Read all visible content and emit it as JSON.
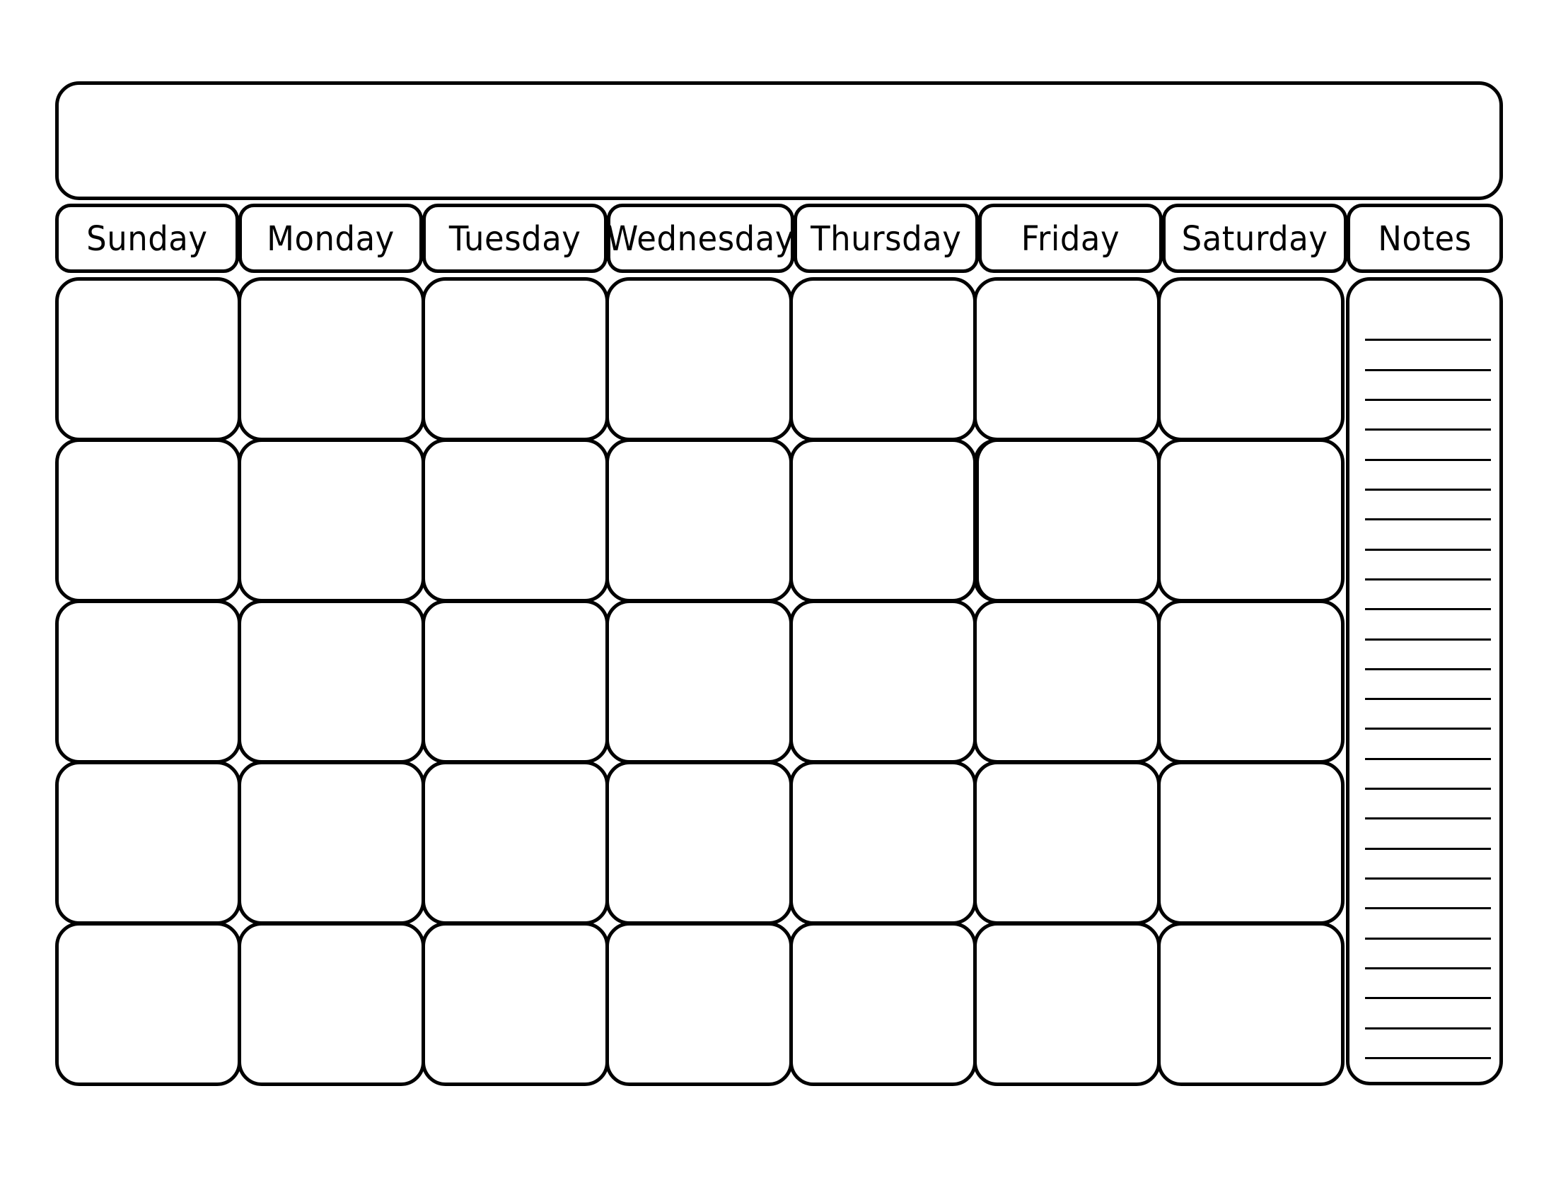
{
  "document": {
    "type": "blank-monthly-calendar-template",
    "orientation": "landscape",
    "background_color": "#ffffff",
    "line_color": "#000000"
  },
  "title_bar": {
    "label": "",
    "placeholder": ""
  },
  "header": {
    "columns": [
      {
        "label": "Sunday",
        "key": "sunday"
      },
      {
        "label": "Monday",
        "key": "monday"
      },
      {
        "label": "Tuesday",
        "key": "tuesday"
      },
      {
        "label": "Wednesday",
        "key": "wednesday"
      },
      {
        "label": "Thursday",
        "key": "thursday"
      },
      {
        "label": "Friday",
        "key": "friday"
      },
      {
        "label": "Saturday",
        "key": "saturday"
      },
      {
        "label": "Notes",
        "key": "notes"
      }
    ]
  },
  "grid": {
    "rows": 5,
    "columns": 7,
    "cells": [
      [
        "",
        "",
        "",
        "",
        "",
        "",
        ""
      ],
      [
        "",
        "",
        "",
        "",
        "",
        "",
        ""
      ],
      [
        "",
        "",
        "",
        "",
        "",
        "",
        ""
      ],
      [
        "",
        "",
        "",
        "",
        "",
        "",
        ""
      ],
      [
        "",
        "",
        "",
        "",
        "",
        "",
        ""
      ]
    ]
  },
  "notes": {
    "label": "Notes",
    "line_count": 25,
    "lines": [
      "",
      "",
      "",
      "",
      "",
      "",
      "",
      "",
      "",
      "",
      "",
      "",
      "",
      "",
      "",
      "",
      "",
      "",
      "",
      "",
      "",
      "",
      "",
      "",
      ""
    ]
  }
}
